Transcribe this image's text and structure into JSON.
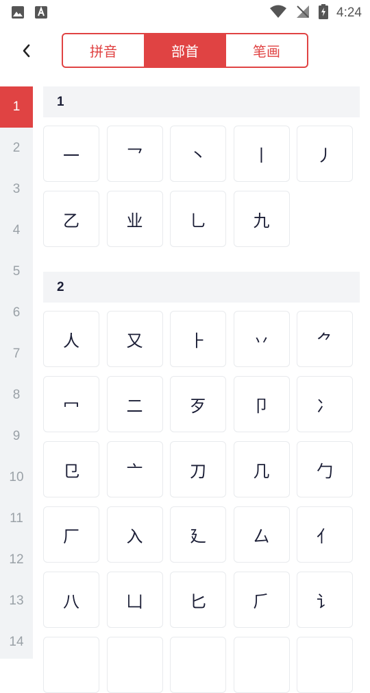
{
  "status_bar": {
    "time": "4:24"
  },
  "tabs": [
    {
      "label": "拼音",
      "active": false
    },
    {
      "label": "部首",
      "active": true
    },
    {
      "label": "笔画",
      "active": false
    }
  ],
  "index": [
    "1",
    "2",
    "3",
    "4",
    "5",
    "6",
    "7",
    "8",
    "9",
    "10",
    "11",
    "12",
    "13",
    "14"
  ],
  "groups": [
    {
      "title": "1",
      "radicals": [
        "一",
        "乛",
        "丶",
        "丨",
        "丿",
        "乙",
        "业",
        "乚",
        "九"
      ]
    },
    {
      "title": "2",
      "radicals": [
        "人",
        "又",
        "⺊",
        "丷",
        "⺈",
        "冖",
        "二",
        "歹",
        "卩",
        "冫",
        "㔾",
        "亠",
        "刀",
        "几",
        "勹",
        "厂",
        "入",
        "廴",
        "厶",
        "亻",
        "八",
        "凵",
        "匕",
        "⺁",
        "讠",
        "",
        "",
        "",
        "",
        ""
      ]
    }
  ],
  "colors": {
    "accent": "#e04343",
    "text": "#1b1e36",
    "sidebar_bg": "#f1f3f5"
  }
}
